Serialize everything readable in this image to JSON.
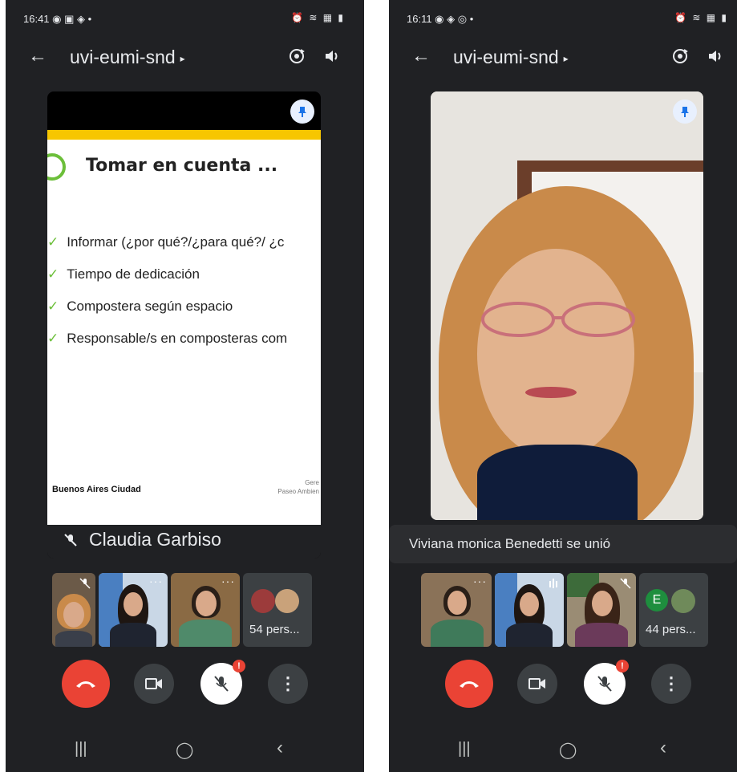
{
  "left_screen": {
    "status": {
      "time": "16:41 ◉ ▣ ◈ •",
      "right": "⏰ ≋ ▦ ▮"
    },
    "meeting": {
      "code": "uvi-eumi-snd",
      "back_icon": "arrow-left-icon",
      "caret": "▸"
    },
    "slide": {
      "heading": "Tomar en cuenta ...",
      "bullets": [
        "Informar (¿por qué?/¿para qué?/ ¿c",
        "Tiempo de dedicación",
        "Compostera según espacio",
        "Responsable/s en composteras com"
      ],
      "logo_text": "Buenos Aires Ciudad",
      "org_text": [
        "Gere",
        "Paseo Ambien"
      ]
    },
    "presenter_name": "Claudia Garbiso",
    "overflow_label": "54 pers...",
    "thumb_more": "···",
    "nav": {
      "recent": "|||",
      "home": "◯",
      "back": "‹"
    }
  },
  "right_screen": {
    "status": {
      "time": "16:11 ◉ ◈ ◎ •",
      "right": "⏰ ≋ ▦ ▮"
    },
    "meeting": {
      "code": "uvi-eumi-snd",
      "back_icon": "arrow-left-icon",
      "caret": "▸"
    },
    "toast": "Viviana monica Benedetti se unió",
    "avatar_letter": "E",
    "overflow_label": "44 pers...",
    "thumb_more": "···",
    "mic_badge": "!",
    "more_dots": "⋮",
    "nav": {
      "recent": "|||",
      "home": "◯",
      "back": "‹"
    }
  },
  "left_mic_badge": "!",
  "left_more_dots": "⋮",
  "colors": {
    "background": "#202124",
    "end_call": "#ea4335",
    "slide_accent": "#f7c600",
    "check": "#6cbf3a",
    "avatar_e": "#1e8e3e"
  }
}
